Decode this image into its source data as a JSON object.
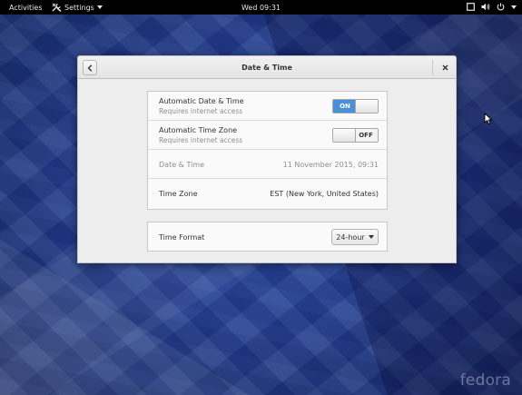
{
  "topbar": {
    "activities": "Activities",
    "app_menu": "Settings",
    "clock": "Wed 09:31"
  },
  "window": {
    "title": "Date & Time"
  },
  "settings": {
    "auto_datetime": {
      "label": "Automatic Date & Time",
      "sub": "Requires internet access",
      "state": "ON"
    },
    "auto_timezone": {
      "label": "Automatic Time Zone",
      "sub": "Requires internet access",
      "state": "OFF"
    },
    "datetime": {
      "label": "Date & Time",
      "value": "11 November 2015, 09:31"
    },
    "timezone": {
      "label": "Time Zone",
      "value": "EST (New York, United States)"
    },
    "time_format": {
      "label": "Time Format",
      "value": "24-hour"
    }
  },
  "desktop": {
    "logo": "fedora"
  },
  "colors": {
    "accent": "#4a90d9",
    "topbar": "#000000",
    "wallpaper": "#243f8f"
  },
  "icons": [
    "settings-icon",
    "screen-icon",
    "volume-icon",
    "power-icon",
    "back-icon",
    "close-icon",
    "mouse-pointer-icon"
  ]
}
